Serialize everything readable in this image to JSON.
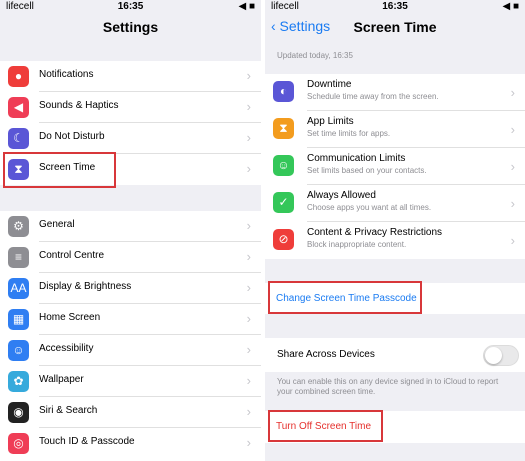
{
  "left": {
    "status": {
      "carrier": "lifecell",
      "time": "16:35",
      "battery": "◀ ■"
    },
    "title": "Settings",
    "group1": [
      {
        "label": "Notifications",
        "icon": "notifications-icon",
        "glyph": "●",
        "color": "#ef3d3a"
      },
      {
        "label": "Sounds & Haptics",
        "icon": "speaker-icon",
        "glyph": "◀",
        "color": "#ef3d56"
      },
      {
        "label": "Do Not Disturb",
        "icon": "moon-icon",
        "glyph": "☾",
        "color": "#5a56d6"
      },
      {
        "label": "Screen Time",
        "icon": "hourglass-icon",
        "glyph": "⧗",
        "color": "#5a56d6"
      }
    ],
    "group2": [
      {
        "label": "General",
        "icon": "gear-icon",
        "glyph": "⚙",
        "color": "#8e8e93"
      },
      {
        "label": "Control Centre",
        "icon": "toggles-icon",
        "glyph": "≡",
        "color": "#8e8e93"
      },
      {
        "label": "Display & Brightness",
        "icon": "text-size-icon",
        "glyph": "AA",
        "color": "#2f7ef2"
      },
      {
        "label": "Home Screen",
        "icon": "grid-icon",
        "glyph": "▦",
        "color": "#2f7ef2"
      },
      {
        "label": "Accessibility",
        "icon": "accessibility-icon",
        "glyph": "☺",
        "color": "#2f7ef2"
      },
      {
        "label": "Wallpaper",
        "icon": "flower-icon",
        "glyph": "✿",
        "color": "#36aadc"
      },
      {
        "label": "Siri & Search",
        "icon": "siri-icon",
        "glyph": "◉",
        "color": "#222"
      },
      {
        "label": "Touch ID & Passcode",
        "icon": "fingerprint-icon",
        "glyph": "◎",
        "color": "#ef3d56"
      }
    ],
    "chevron": "›"
  },
  "right": {
    "status": {
      "carrier": "lifecell",
      "time": "16:35",
      "battery": "◀ ■"
    },
    "back_label": "‹ Settings",
    "title": "Screen Time",
    "updated": "Updated today, 16:35",
    "items": [
      {
        "label": "Downtime",
        "sub": "Schedule time away from the screen.",
        "icon": "downtime-icon",
        "glyph": "◐",
        "color": "#5a56d6"
      },
      {
        "label": "App Limits",
        "sub": "Set time limits for apps.",
        "icon": "hourglass-icon",
        "glyph": "⧗",
        "color": "#f39c1e"
      },
      {
        "label": "Communication Limits",
        "sub": "Set limits based on your contacts.",
        "icon": "contact-icon",
        "glyph": "☺",
        "color": "#34c759"
      },
      {
        "label": "Always Allowed",
        "sub": "Choose apps you want at all times.",
        "icon": "checkmark-icon",
        "glyph": "✓",
        "color": "#34c759"
      },
      {
        "label": "Content & Privacy Restrictions",
        "sub": "Block inappropriate content.",
        "icon": "restriction-icon",
        "glyph": "⊘",
        "color": "#ef3d3a"
      }
    ],
    "passcode_link": "Change Screen Time Passcode",
    "share_label": "Share Across Devices",
    "share_on": false,
    "share_note": "You can enable this on any device signed in to iCloud to report your combined screen time.",
    "turn_off": "Turn Off Screen Time",
    "chevron": "›",
    "colors": {
      "link": "#1a7bf2",
      "danger": "#e5302d",
      "highlight": "#d8373a"
    }
  }
}
